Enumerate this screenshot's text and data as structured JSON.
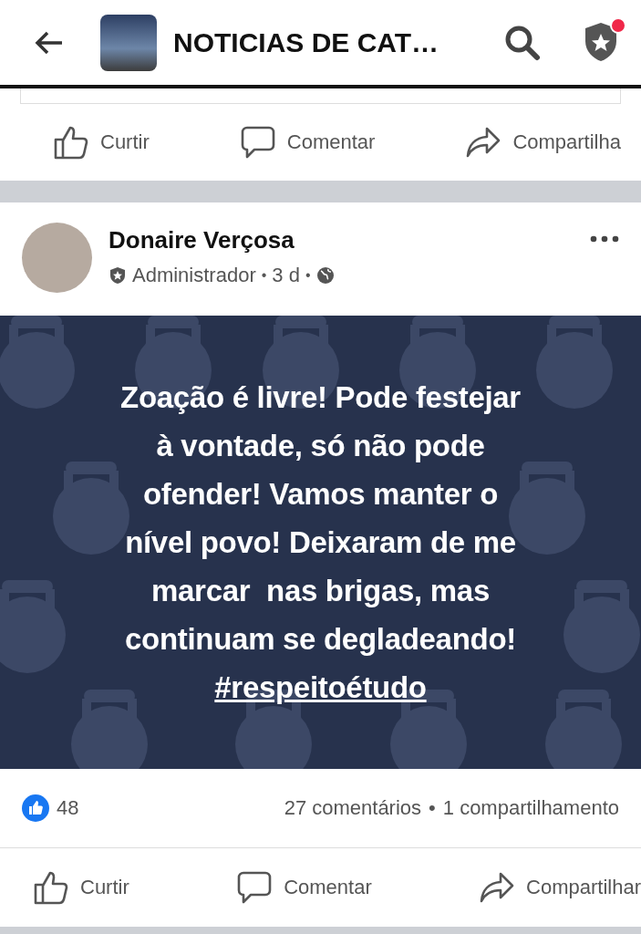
{
  "top_bar": {
    "title": "NOTICIAS DE CAT…",
    "notification": true
  },
  "previous_post": {
    "actions": [
      {
        "kind": "like",
        "label": "Curtir"
      },
      {
        "kind": "comment",
        "label": "Comentar"
      },
      {
        "kind": "share",
        "label": "Compartilha"
      }
    ]
  },
  "post": {
    "author": "Donaire Verçosa",
    "role": "Administrador",
    "time": "3 d",
    "separator": "•",
    "lines": [
      "Zoação é livre! Pode festejar",
      "à vontade, só não pode",
      "ofender! Vamos manter o",
      "nível povo! Deixaram de me",
      "marcar  nas brigas, mas",
      "continuam se degladeando!"
    ],
    "hashtag": "#respeitoétudo",
    "reactions": "48",
    "comments": "27 comentários",
    "shares": "1 compartilhamento",
    "actions": [
      {
        "kind": "like",
        "label": "Curtir"
      },
      {
        "kind": "comment",
        "label": "Comentar"
      },
      {
        "kind": "share",
        "label": "Compartilhar"
      }
    ]
  }
}
